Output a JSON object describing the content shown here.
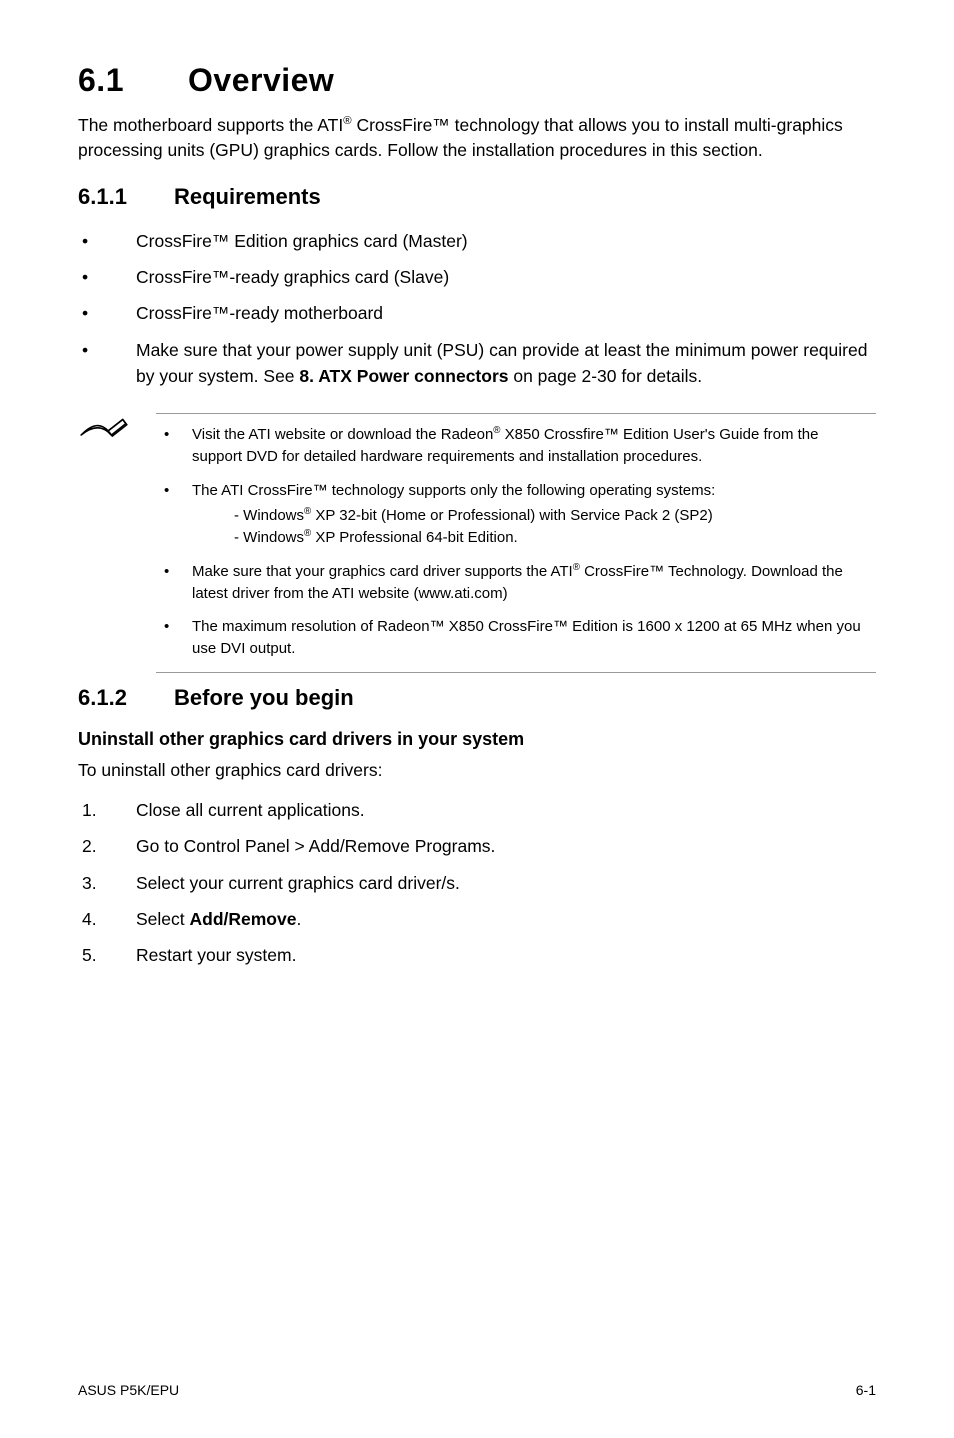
{
  "section": {
    "number": "6.1",
    "title": "Overview",
    "intro_pre": "The motherboard supports the ATI",
    "intro_sup": "®",
    "intro_post": " CrossFire™ technology that allows you to install multi-graphics processing units (GPU) graphics cards. Follow the installation procedures in this section."
  },
  "sub1": {
    "number": "6.1.1",
    "title": "Requirements",
    "bullets": [
      "CrossFire™ Edition graphics card (Master)",
      "CrossFire™-ready graphics card (Slave)",
      "CrossFire™-ready motherboard"
    ],
    "bullet4_pre": "Make sure that your power supply unit (PSU) can provide at least the minimum power required by your system. See ",
    "bullet4_bold": "8. ATX Power connectors",
    "bullet4_post": " on page 2-30 for details."
  },
  "note": {
    "item1_pre": "Visit the ATI website or download the Radeon",
    "item1_sup": "®",
    "item1_post": " X850 Crossfire™ Edition User's Guide from the support DVD for detailed hardware requirements and installation procedures.",
    "item2": "The ATI CrossFire™ technology supports only the following operating systems:",
    "item2_sub1_pre": "- Windows",
    "item2_sub1_sup": "®",
    "item2_sub1_post": " XP 32-bit  (Home or Professional) with Service   Pack 2 (SP2)",
    "item2_sub2_pre": "- Windows",
    "item2_sub2_sup": "®",
    "item2_sub2_post": " XP Professional 64-bit Edition.",
    "item3_pre": "Make sure that your graphics card driver supports the ATI",
    "item3_sup": "®",
    "item3_post": " CrossFire™ Technology. Download the latest driver from the ATI website (www.ati.com)",
    "item4": "The maximum resolution of Radeon™ X850 CrossFire™ Edition is 1600 x 1200 at 65 MHz when you use DVI output."
  },
  "sub2": {
    "number": "6.1.2",
    "title": "Before you begin",
    "heading": "Uninstall other graphics card drivers in your system",
    "lead": "To uninstall other graphics card drivers:",
    "steps": {
      "s1": "Close all current applications.",
      "s2": "Go to Control Panel > Add/Remove Programs.",
      "s3": "Select your current graphics card driver/s.",
      "s4_pre": "Select ",
      "s4_bold": "Add/Remove",
      "s4_post": ".",
      "s5": "Restart your system."
    }
  },
  "footer": {
    "left": "ASUS P5K/EPU",
    "right": "6-1"
  }
}
